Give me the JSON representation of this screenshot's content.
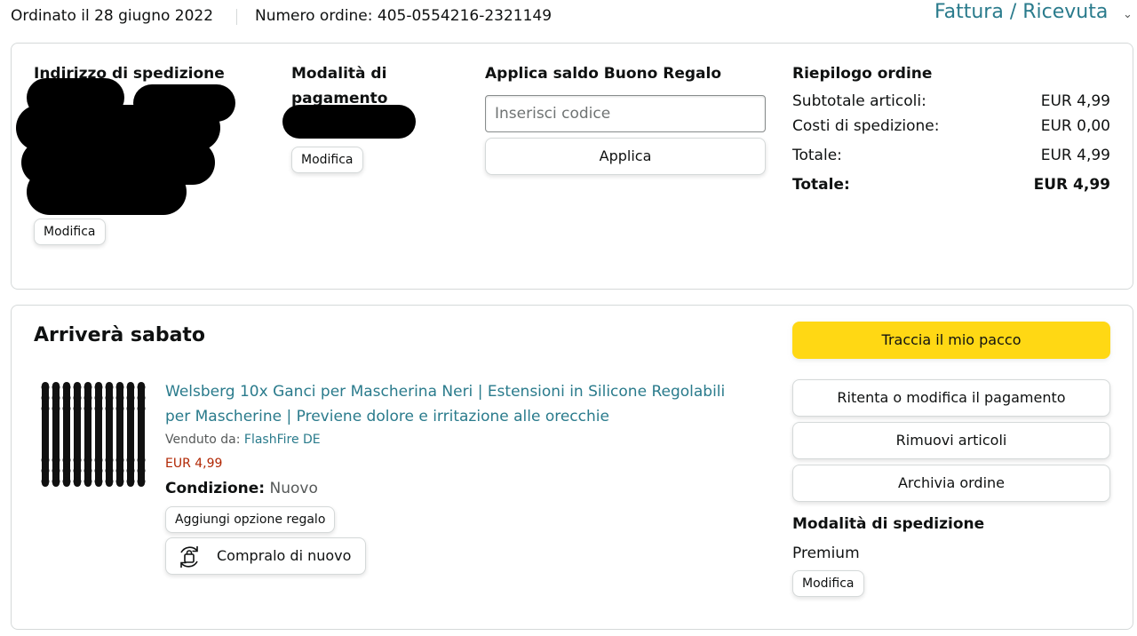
{
  "header": {
    "order_date": "Ordinato il 28 giugno 2022",
    "order_number": "Numero ordine: 405-0554216-2321149",
    "invoice_link": "Fattura / Ricevuta",
    "invoice_chevron": "⌄"
  },
  "order_info": {
    "shipping_address": {
      "title": "Indirizzo di spedizione",
      "edit_label": "Modifica"
    },
    "payment": {
      "title": "Modalità di pagamento",
      "edit_label": "Modifica"
    },
    "gift_card": {
      "title": "Applica saldo Buono Regalo",
      "placeholder": "Inserisci codice",
      "apply_label": "Applica"
    },
    "summary": {
      "title": "Riepilogo ordine",
      "rows": [
        {
          "label": "Subtotale articoli:",
          "value": "EUR 4,99"
        },
        {
          "label": "Costi di spedizione:",
          "value": "EUR 0,00"
        },
        {
          "label": "Totale:",
          "value": "EUR 4,99"
        },
        {
          "label": "Totale:",
          "value": "EUR 4,99"
        }
      ]
    }
  },
  "shipment": {
    "arrival": "Arriverà sabato",
    "track_label": "Traccia il mio pacco",
    "actions": [
      {
        "label": "Ritenta o modifica il pagamento"
      },
      {
        "label": "Rimuovi articoli"
      },
      {
        "label": "Archivia ordine"
      }
    ],
    "shipping_mode": {
      "title": "Modalità di spedizione",
      "value": "Premium",
      "edit_label": "Modifica"
    },
    "product": {
      "title": "Welsberg 10x Ganci per Mascherina Neri | Estensioni in Silicone Regolabili per Mascherine | Previene dolore e irritazione alle orecchie",
      "sold_by_label": "Venduto da:",
      "seller": "FlashFire DE",
      "price": "EUR 4,99",
      "condition_label": "Condizione:",
      "condition_value": "Nuovo",
      "gift_option_label": "Aggiungi opzione regalo",
      "buy_again_label": "Compralo di nuovo",
      "buy_again_icon": "buy-again-icon"
    }
  },
  "colors": {
    "link": "#2a7b8c",
    "price": "#b12704",
    "track_button": "#ffd814",
    "border": "#d5d9d9"
  }
}
